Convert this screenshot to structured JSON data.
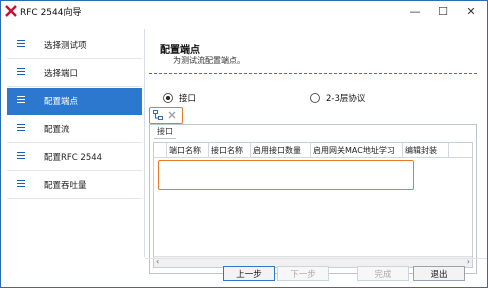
{
  "window": {
    "title": "RFC 2544向导",
    "controls": {
      "minimize": "—",
      "maximize": "☐",
      "close": "✕"
    }
  },
  "sidebar": {
    "items": [
      {
        "label": "选择测试项",
        "active": false
      },
      {
        "label": "选择端口",
        "active": false
      },
      {
        "label": "配置端点",
        "active": true
      },
      {
        "label": "配置流",
        "active": false
      },
      {
        "label": "配置RFC 2544",
        "active": false
      },
      {
        "label": "配置吞吐量",
        "active": false
      }
    ]
  },
  "content": {
    "title": "配置端点",
    "subtitle": "为测试流配置端点。",
    "radios": [
      {
        "label": "接口",
        "checked": true
      },
      {
        "label": "2-3层协议",
        "checked": false
      }
    ],
    "group_label": "接口",
    "columns": [
      "端口名称",
      "接口名称",
      "启用接口数量",
      "启用网关MAC地址学习",
      "编辑封装"
    ]
  },
  "footer": {
    "prev": "上一步",
    "next": "下一步",
    "finish": "完成",
    "exit": "退出"
  },
  "colors": {
    "accent": "#2c78cf",
    "highlight": "#e87a2a"
  },
  "icons": {
    "add": "add-interface-icon",
    "delete": "delete-icon",
    "logo": "app-logo-icon"
  }
}
